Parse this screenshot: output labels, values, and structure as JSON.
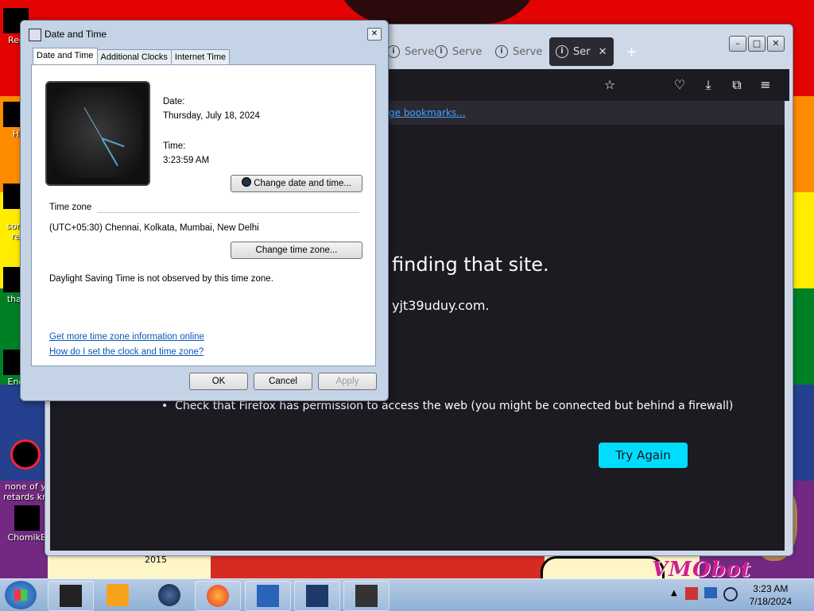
{
  "colors": {
    "stripes": [
      "#e40303",
      "#ff8c00",
      "#ffed00",
      "#008026",
      "#24408e",
      "#732982"
    ]
  },
  "desktop": {
    "icons": [
      {
        "label": "Rec",
        "icon": "recycle-bin-icon"
      },
      {
        "label": "H",
        "icon": "app-icon"
      },
      {
        "label": "som\nre",
        "icon": "app-icon"
      },
      {
        "label": "that",
        "icon": "app-icon"
      },
      {
        "label": "End",
        "icon": "app-icon"
      },
      {
        "label": "none of y\nretards kn",
        "icon": "app-icon"
      },
      {
        "label": "ChomikB",
        "icon": "app-icon"
      }
    ],
    "year_label": "2015",
    "watermark": "VMObot"
  },
  "browser": {
    "tabs": [
      {
        "label": "Serve",
        "icon": "info-icon"
      },
      {
        "label": "Serve",
        "icon": "info-icon"
      },
      {
        "label": "Serve",
        "icon": "info-icon"
      },
      {
        "label": "Ser",
        "icon": "info-icon"
      }
    ],
    "bookmarks_link": "ge bookmarks...",
    "error_title": "finding that site.",
    "error_sub": "yjt39uduy.com.",
    "bullet": "Check that Firefox has permission to access the web (you might be connected but behind a firewall)",
    "try_again": "Try Again"
  },
  "dialog": {
    "title": "Date and Time",
    "tabs": [
      "Date and Time",
      "Additional Clocks",
      "Internet Time"
    ],
    "date_label": "Date:",
    "date_value": "Thursday, July 18, 2024",
    "time_label": "Time:",
    "time_value": "3:23:59 AM",
    "change_date_btn": "Change date and time...",
    "tz_header": "Time zone",
    "tz_value": "(UTC+05:30) Chennai, Kolkata, Mumbai, New Delhi",
    "change_tz_btn": "Change time zone...",
    "dst_note": "Daylight Saving Time is not observed by this time zone.",
    "link1": "Get more time zone information online",
    "link2": "How do I set the clock and time zone?",
    "ok": "OK",
    "cancel": "Cancel",
    "apply": "Apply"
  },
  "taskbar": {
    "time": "3:23 AM",
    "date": "7/18/2024"
  }
}
